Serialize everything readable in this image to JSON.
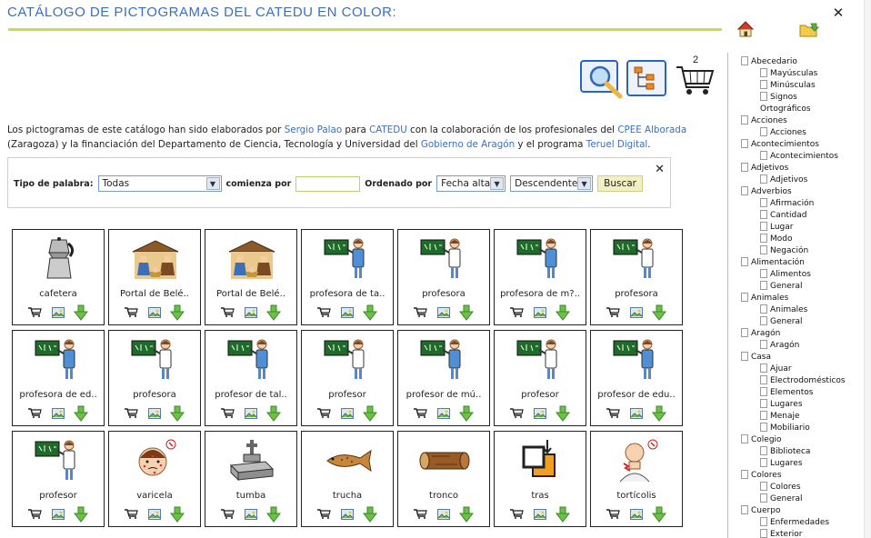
{
  "header": {
    "title": "CATÁLOGO DE PICTOGRAMAS DEL CATEDU EN COLOR:",
    "close_label": "✕"
  },
  "toolbar": {
    "cart_count": "2"
  },
  "intro": {
    "t1": "Los pictogramas de este catálogo han sido elaborados por ",
    "l1": "Sergio Palao",
    "t2": " para ",
    "l2": "CATEDU",
    "t3": " con la colaboración de los profesionales del ",
    "l3": "CPEE Alborada",
    "t4": " (Zaragoza) y la financiación del Departamento de Ciencia, Tecnología y Universidad del ",
    "l4": "Gobierno de Aragón",
    "t5": " y el programa ",
    "l5": "Teruel Digital",
    "t6": "."
  },
  "filter": {
    "tipo_label": "Tipo de palabra:",
    "tipo_value": "Todas",
    "comienza_label": "comienza por",
    "comienza_value": "",
    "ordenado_label": "Ordenado por",
    "orden_value": "Fecha alta",
    "direccion_value": "Descendente",
    "buscar_label": "Buscar",
    "close_label": "✕"
  },
  "cards": [
    {
      "label": "cafetera",
      "icon": "coffee-maker-icon"
    },
    {
      "label": "Portal de Belé..",
      "icon": "nativity-scene-icon"
    },
    {
      "label": "Portal de Belé..",
      "icon": "nativity-scene-icon"
    },
    {
      "label": "profesora de ta..",
      "icon": "teacher-icon"
    },
    {
      "label": "profesora",
      "icon": "teacher-icon"
    },
    {
      "label": "profesora de m?..",
      "icon": "teacher-icon"
    },
    {
      "label": "profesora",
      "icon": "teacher-icon"
    },
    {
      "label": "profesora de ed..",
      "icon": "teacher-icon"
    },
    {
      "label": "profesora",
      "icon": "teacher-icon"
    },
    {
      "label": "profesor de tal..",
      "icon": "teacher-icon"
    },
    {
      "label": "profesor",
      "icon": "teacher-icon"
    },
    {
      "label": "profesor de mú..",
      "icon": "teacher-icon"
    },
    {
      "label": "profesor",
      "icon": "teacher-icon"
    },
    {
      "label": "profesor de edu..",
      "icon": "teacher-icon"
    },
    {
      "label": "profesor",
      "icon": "teacher-icon"
    },
    {
      "label": "varicela",
      "icon": "chickenpox-face-icon"
    },
    {
      "label": "tumba",
      "icon": "tomb-icon"
    },
    {
      "label": "trucha",
      "icon": "trout-icon"
    },
    {
      "label": "tronco",
      "icon": "log-icon"
    },
    {
      "label": "tras",
      "icon": "behind-icon"
    },
    {
      "label": "tortícolis",
      "icon": "stiff-neck-icon"
    }
  ],
  "tree": [
    {
      "label": "Abecedario",
      "level": 0
    },
    {
      "label": "Mayúsculas",
      "level": 1
    },
    {
      "label": "Minúsculas",
      "level": 1
    },
    {
      "label": "Signos Ortográficos",
      "level": 1
    },
    {
      "label": "Acciones",
      "level": 0
    },
    {
      "label": "Acciones",
      "level": 1
    },
    {
      "label": "Acontecimientos",
      "level": 0
    },
    {
      "label": "Acontecimientos",
      "level": 1
    },
    {
      "label": "Adjetivos",
      "level": 0
    },
    {
      "label": "Adjetivos",
      "level": 1
    },
    {
      "label": "Adverbios",
      "level": 0
    },
    {
      "label": "Afirmación",
      "level": 1
    },
    {
      "label": "Cantidad",
      "level": 1
    },
    {
      "label": "Lugar",
      "level": 1
    },
    {
      "label": "Modo",
      "level": 1
    },
    {
      "label": "Negación",
      "level": 1
    },
    {
      "label": "Alimentación",
      "level": 0
    },
    {
      "label": "Alimentos",
      "level": 1
    },
    {
      "label": "General",
      "level": 1
    },
    {
      "label": "Animales",
      "level": 0
    },
    {
      "label": "Animales",
      "level": 1
    },
    {
      "label": "General",
      "level": 1
    },
    {
      "label": "Aragón",
      "level": 0
    },
    {
      "label": "Aragón",
      "level": 1
    },
    {
      "label": "Casa",
      "level": 0
    },
    {
      "label": "Ajuar",
      "level": 1
    },
    {
      "label": "Electrodomésticos",
      "level": 1
    },
    {
      "label": "Elementos",
      "level": 1
    },
    {
      "label": "Lugares",
      "level": 1
    },
    {
      "label": "Menaje",
      "level": 1
    },
    {
      "label": "Mobiliario",
      "level": 1
    },
    {
      "label": "Colegio",
      "level": 0
    },
    {
      "label": "Biblioteca",
      "level": 1
    },
    {
      "label": "Lugares",
      "level": 1
    },
    {
      "label": "Colores",
      "level": 0
    },
    {
      "label": "Colores",
      "level": 1
    },
    {
      "label": "General",
      "level": 1
    },
    {
      "label": "Cuerpo",
      "level": 0
    },
    {
      "label": "Enfermedades",
      "level": 1
    },
    {
      "label": "Exterior",
      "level": 1
    }
  ],
  "colors": {
    "title_blue": "#3a6fc0",
    "rule_green": "#c6de4a",
    "link_blue": "#3a6fc0"
  }
}
